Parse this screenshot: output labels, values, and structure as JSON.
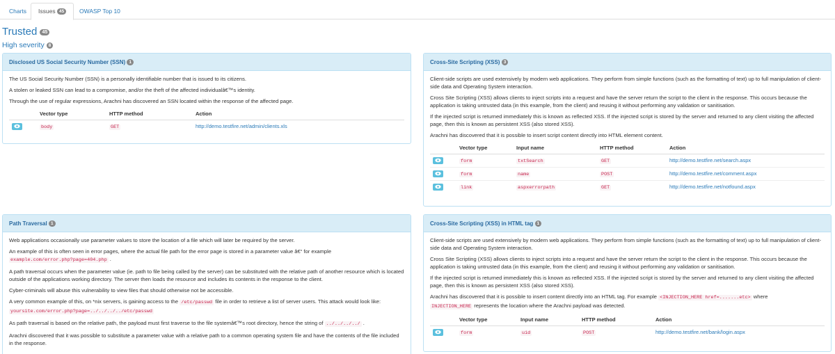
{
  "tabs": [
    {
      "label": "Charts"
    },
    {
      "label": "Issues",
      "badge": "45"
    },
    {
      "label": "OWASP Top 10"
    }
  ],
  "heading": {
    "title": "Trusted",
    "count": "45"
  },
  "severity": {
    "label": "High severity",
    "count": "8"
  },
  "panels": {
    "ssn": {
      "title": "Disclosed US Social Security Number (SSN)",
      "count": "1",
      "paragraphs": [
        "The US Social Security Number (SSN) is a personally identifiable number that is issued to its citizens.",
        "A stolen or leaked SSN can lead to a compromise, and/or the theft of the affected individualâ€™s identity.",
        "Through the use of regular expressions, Arachni has discovered an SSN located within the response of the affected page."
      ],
      "headers": [
        "Vector type",
        "HTTP method",
        "Action"
      ],
      "rows": [
        {
          "vector": "body",
          "method": "GET",
          "action": "http://demo.testfire.net/admin/clients.xls"
        }
      ]
    },
    "xss": {
      "title": "Cross-Site Scripting (XSS)",
      "count": "3",
      "paragraphs": [
        "Client-side scripts are used extensively by modern web applications. They perform from simple functions (such as the formatting of text) up to full manipulation of client-side data and Operating System interaction.",
        "Cross Site Scripting (XSS) allows clients to inject scripts into a request and have the server return the script to the client in the response. This occurs because the application is taking untrusted data (in this example, from the client) and reusing it without performing any validation or sanitisation.",
        "If the injected script is returned immediately this is known as reflected XSS. If the injected script is stored by the server and returned to any client visiting the affected page, then this is known as persistent XSS (also stored XSS).",
        "Arachni has discovered that it is possible to insert script content directly into HTML element content."
      ],
      "headers": [
        "Vector type",
        "Input name",
        "HTTP method",
        "Action"
      ],
      "rows": [
        {
          "vector": "form",
          "input": "txtSearch",
          "method": "GET",
          "action": "http://demo.testfire.net/search.aspx"
        },
        {
          "vector": "form",
          "input": "name",
          "method": "POST",
          "action": "http://demo.testfire.net/comment.aspx"
        },
        {
          "vector": "link",
          "input": "aspxerrorpath",
          "method": "GET",
          "action": "http://demo.testfire.net/notfound.aspx"
        }
      ]
    },
    "path": {
      "title": "Path Traversal",
      "count": "1",
      "p1": "Web applications occasionally use parameter values to store the location of a file which will later be required by the server.",
      "p2": "An example of this is often seen in error pages, where the actual file path for the error page is stored in a parameter value â€“ for example",
      "p2_code": "example.com/error.php?page=404.php",
      "p3": "A path traversal occurs when the parameter value (ie. path to file being called by the server) can be substituted with the relative path of another resource which is located outside of the applications working directory. The server then loads the resource and includes its contents in the response to the client.",
      "p4": "Cyber-criminals will abuse this vulnerability to view files that should otherwise not be accessible.",
      "p5": "A very common example of this, on *nix servers, is gaining access to the",
      "p5_code": "/etc/passwd",
      "p5_rest": "file in order to retrieve a list of server users. This attack would look like:",
      "p5_code2": "yoursite.com/error.php?page=../../../../etc/passwd",
      "p6": "As path traversal is based on the relative path, the payload must first traverse to the file systemâ€™s root directory, hence the string of",
      "p6_code": "../../../../",
      "p7": "Arachni discovered that it was possible to substitute a parameter value with a relative path to a common operating system file and have the contents of the file included in the response."
    },
    "xss_tag": {
      "title": "Cross-Site Scripting (XSS) in HTML tag",
      "count": "1",
      "paragraphs": [
        "Client-side scripts are used extensively by modern web applications. They perform from simple functions (such as the formatting of text) up to full manipulation of client-side data and Operating System interaction.",
        "Cross Site Scripting (XSS) allows clients to inject scripts into a request and have the server return the script to the client in the response. This occurs because the application is taking untrusted data (in this example, from the client) and reusing it without performing any validation or sanitisation.",
        "If the injected script is returned immediately this is known as reflected XSS. If the injected script is stored by the server and returned to any client visiting the affected page, then this is known as persistent XSS (also stored XSS)."
      ],
      "p_last": "Arachni has discovered that it is possible to insert content directly into an HTML tag. For example",
      "p_last_code": "<INJECTION_HERE href=.......etc>",
      "p_last_mid": "where",
      "p_last_code2": "INJECTION_HERE",
      "p_last_end": "represents the location where the Arachni payload was detected.",
      "headers": [
        "Vector type",
        "Input name",
        "HTTP method",
        "Action"
      ],
      "rows": [
        {
          "vector": "form",
          "input": "uid",
          "method": "POST",
          "action": "http://demo.testfire.net/bank/login.aspx"
        }
      ]
    }
  },
  "colors": {
    "accent": "#2a7ab8",
    "panel_head": "#d9edf7",
    "eye_button": "#5bc0de",
    "code": "#c7254e"
  },
  "icons": {
    "view_button": "eye-icon"
  }
}
